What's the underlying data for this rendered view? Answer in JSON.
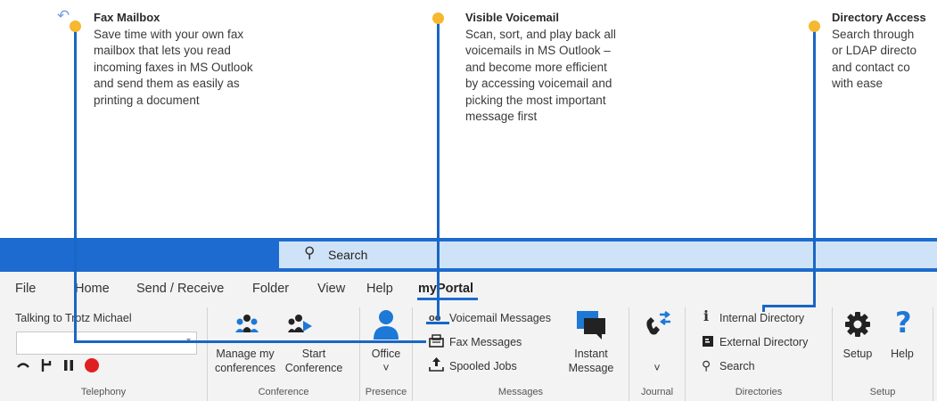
{
  "callouts": [
    {
      "title": "Fax Mailbox",
      "text": "Save time with your own fax\nmailbox that lets you read\nincoming faxes in MS Outlook\nand send them as easily as\nprinting a document"
    },
    {
      "title": "Visible Voicemail",
      "text": "Scan, sort, and play back all\nvoicemails in MS Outlook –\nand become more efficient\nby accessing voicemail and\npicking the most important\nmessage first"
    },
    {
      "title": "Directory Access",
      "text": "Search through\nor LDAP directo\nand contact co\nwith ease"
    }
  ],
  "titlebar": {
    "search_label": "Search",
    "accent": "#1d6bd0",
    "search_bg": "#cfe3f8"
  },
  "menu": {
    "items": [
      "File",
      "Home",
      "Send / Receive",
      "Folder",
      "View",
      "Help",
      "myPortal"
    ],
    "active": "myPortal"
  },
  "ribbon": {
    "telephony": {
      "status": "Talking to Trotz Michael",
      "combo_value": "",
      "group_label": "Telephony",
      "icons": [
        "hangup-icon",
        "transfer-icon",
        "pause-icon",
        "record-icon"
      ]
    },
    "conference": {
      "manage_label": "Manage my\nconferences",
      "start_label": "Start\nConference",
      "group_label": "Conference"
    },
    "presence": {
      "status_label": "Office",
      "dropdown": "˅",
      "group_label": "Presence"
    },
    "messages": {
      "voicemail_label": "Voicemail Messages",
      "fax_label": "Fax Messages",
      "spooled_label": "Spooled Jobs",
      "instant_label": "Instant\nMessage",
      "group_label": "Messages"
    },
    "journal": {
      "dropdown": "˅",
      "group_label": "Journal"
    },
    "directories": {
      "internal_label": "Internal Directory",
      "external_label": "External Directory",
      "search_label": "Search",
      "group_label": "Directories"
    },
    "setup": {
      "setup_label": "Setup",
      "help_label": "Help",
      "group_label": "Setup"
    }
  },
  "colors": {
    "callout_dot": "#f5b82e",
    "leader_line": "#1a66c4",
    "ribbon_bg": "#f3f3f3",
    "record_red": "#e02020",
    "presence_blue": "#1d78d6"
  }
}
